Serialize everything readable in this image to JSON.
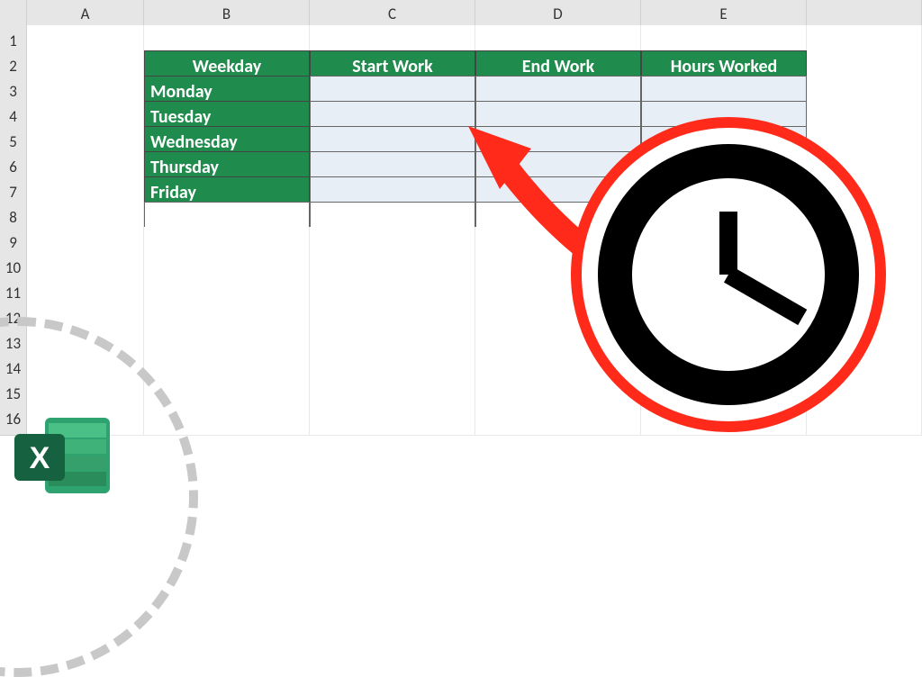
{
  "columns": [
    "",
    "A",
    "B",
    "C",
    "D",
    "E",
    ""
  ],
  "rows": [
    "1",
    "2",
    "3",
    "4",
    "5",
    "6",
    "7",
    "8",
    "9",
    "10",
    "11",
    "12",
    "13",
    "14",
    "15",
    "16"
  ],
  "table": {
    "headers": [
      "Weekday",
      "Start Work",
      "End Work",
      "Hours Worked"
    ],
    "days": [
      "Monday",
      "Tuesday",
      "Wednesday",
      "Thursday",
      "Friday"
    ]
  },
  "colors": {
    "header_bg": "#1f8b4c",
    "data_bg": "#e8eef6",
    "arrow": "#ff2a1a"
  },
  "icons": {
    "excel_letter": "X"
  }
}
